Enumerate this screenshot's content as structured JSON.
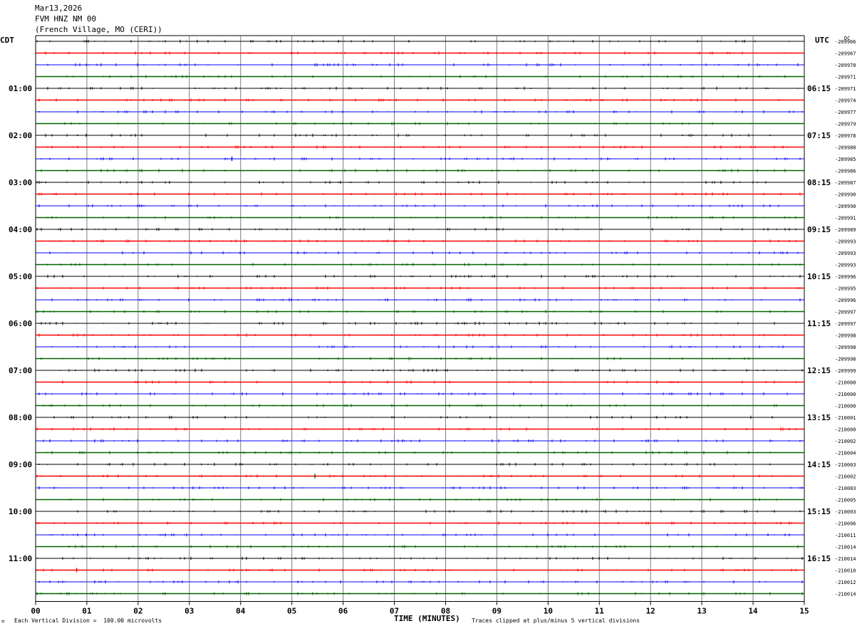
{
  "header": {
    "date": "Mar13,2026",
    "station": "FVM HNZ NM 00",
    "location": "(French Village, MO (CERI))"
  },
  "labels": {
    "left_tz": "CDT",
    "right_tz": "UTC",
    "dc": "DC",
    "xlabel": "TIME (MINUTES)",
    "footer_left": "Each Vertical Division =  100.00 microvolts",
    "footer_right": "Traces clipped at plus/minus 5 vertical divisions"
  },
  "chart_data": {
    "type": "line",
    "title": "FVM HNZ NM 00",
    "xlabel": "TIME (MINUTES)",
    "xlim": [
      0,
      15
    ],
    "x_ticks": [
      "00",
      "01",
      "02",
      "03",
      "04",
      "05",
      "06",
      "07",
      "08",
      "09",
      "10",
      "11",
      "12",
      "13",
      "14",
      "15"
    ],
    "trace_colors": [
      "#000000",
      "#ff0000",
      "#0000ff",
      "#006400"
    ],
    "left_hour_labels": [
      "01:00",
      "02:00",
      "03:00",
      "04:00",
      "05:00",
      "06:00",
      "07:00",
      "08:00",
      "09:00",
      "10:00",
      "11:00"
    ],
    "right_hour_labels": [
      "06:15",
      "07:15",
      "08:15",
      "09:15",
      "10:15",
      "11:15",
      "12:15",
      "13:15",
      "14:15",
      "15:15",
      "16:15"
    ],
    "dc_offsets": [
      "-209966",
      "-209967",
      "-209970",
      "-209971",
      "-209971",
      "-209974",
      "-209977",
      "-209979",
      "-209978",
      "-209988",
      "-209985",
      "-209986",
      "-209987",
      "-209990",
      "-209990",
      "-209991",
      "-209989",
      "-209993",
      "-209993",
      "-209993",
      "-209996",
      "-209995",
      "-209996",
      "-209997",
      "-209997",
      "-209998",
      "-209998",
      "-209998",
      "-209999",
      "-210000",
      "-210000",
      "-210000",
      "-210001",
      "-210000",
      "-210002",
      "-210004",
      "-210003",
      "-210002",
      "-210003",
      "-210005",
      "-210003",
      "-210006",
      "-210011",
      "-210014",
      "-210014",
      "-210010",
      "-210012",
      "-210014"
    ]
  }
}
